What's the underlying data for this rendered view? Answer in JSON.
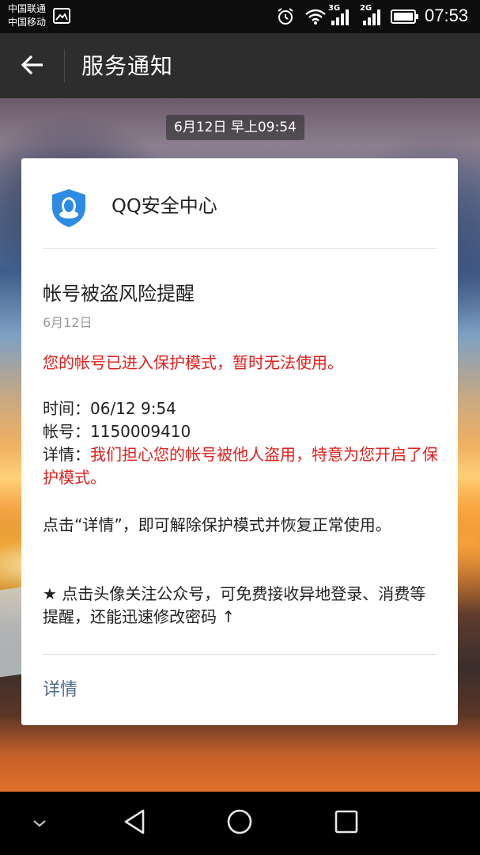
{
  "status_bar": {
    "carrier_1": "中国联通",
    "carrier_2": "中国移动",
    "network_1": "3G",
    "network_2": "2G",
    "time": "07:53",
    "icons": [
      "picture-icon",
      "alarm-icon",
      "wifi-icon",
      "signal-icon",
      "battery-icon"
    ]
  },
  "header": {
    "title": "服务通知",
    "back_icon": "arrow-left-icon"
  },
  "timestamp": "6月12日 早上09:54",
  "card": {
    "sender": "QQ安全中心",
    "sender_icon": "qq-shield-icon",
    "title": "帐号被盗风险提醒",
    "date": "6月12日",
    "warning": "您的帐号已进入保护模式，暂时无法使用。",
    "time_label": "时间：",
    "time_value": "06/12 9:54",
    "account_label": "帐号：",
    "account_value": "1150009410",
    "detail_label": "详情：",
    "detail_value": "我们担心您的帐号被他人盗用，特意为您开启了保护模式。",
    "tip": "点击“详情”，即可解除保护模式并恢复正常使用。",
    "star_tip": "★ 点击头像关注公众号，可免费接收异地登录、消费等提醒，还能迅速修改密码 ↑",
    "detail_link": "详情"
  },
  "colors": {
    "accent_red": "#e0201c",
    "link_blue": "#4e6b8c",
    "shield_blue": "#2d8be3",
    "header_bg": "#2d2d2d"
  },
  "nav_bar": {
    "icons": [
      "chevron-down-icon",
      "triangle-back-icon",
      "circle-home-icon",
      "square-recent-icon"
    ]
  }
}
